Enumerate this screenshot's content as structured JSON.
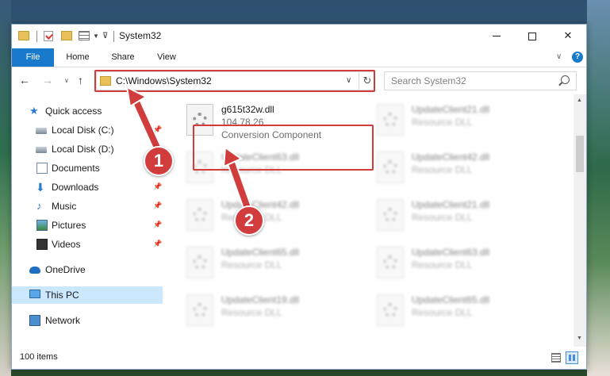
{
  "window": {
    "title": "System32",
    "controls": {
      "minimize": "",
      "maximize": "",
      "close": "✕"
    }
  },
  "ribbon": {
    "tabs": [
      "File",
      "Home",
      "Share",
      "View"
    ],
    "help": "?"
  },
  "navbar": {
    "address": "C:\\Windows\\System32",
    "search_placeholder": "Search System32"
  },
  "sidebar": {
    "items": [
      {
        "label": "Quick access",
        "icon": "star-icon",
        "pinned": false
      },
      {
        "label": "Local Disk (C:)",
        "icon": "drive-c-icon",
        "pinned": true
      },
      {
        "label": "Local Disk (D:)",
        "icon": "drive-icon",
        "pinned": false
      },
      {
        "label": "Documents",
        "icon": "documents-icon",
        "pinned": false
      },
      {
        "label": "Downloads",
        "icon": "downloads-icon",
        "pinned": true
      },
      {
        "label": "Music",
        "icon": "music-icon",
        "pinned": true
      },
      {
        "label": "Pictures",
        "icon": "pictures-icon",
        "pinned": true
      },
      {
        "label": "Videos",
        "icon": "videos-icon",
        "pinned": true
      },
      {
        "label": "OneDrive",
        "icon": "onedrive-icon",
        "pinned": false
      },
      {
        "label": "This PC",
        "icon": "this-pc-icon",
        "pinned": false,
        "selected": true
      },
      {
        "label": "Network",
        "icon": "network-icon",
        "pinned": false
      }
    ]
  },
  "files": [
    {
      "name": "g615t32w.dll",
      "line2": "104.78.26",
      "line3": "Conversion Component",
      "highlighted": true
    },
    {
      "name": "UpdateClient21.dll",
      "line2": "Resource DLL",
      "line3": ""
    },
    {
      "name": "UpdateClient63.dll",
      "line2": "Resource DLL",
      "line3": ""
    },
    {
      "name": "UpdateClient42.dll",
      "line2": "Resource DLL",
      "line3": ""
    },
    {
      "name": "UpdateClient42.dll",
      "line2": "Resource DLL",
      "line3": ""
    },
    {
      "name": "UpdateClient21.dll",
      "line2": "Resource DLL",
      "line3": ""
    },
    {
      "name": "UpdateClient65.dll",
      "line2": "Resource DLL",
      "line3": ""
    },
    {
      "name": "UpdateClient63.dll",
      "line2": "Resource DLL",
      "line3": ""
    },
    {
      "name": "UpdateClient19.dll",
      "line2": "Resource DLL",
      "line3": ""
    },
    {
      "name": "UpdateClient65.dll",
      "line2": "Resource DLL",
      "line3": ""
    }
  ],
  "status": {
    "item_count": "100 items"
  },
  "annotations": {
    "step1": "1",
    "step2": "2"
  },
  "colors": {
    "accent": "#1979ca",
    "highlight": "#d13c3c",
    "selected": "#cce8ff"
  }
}
